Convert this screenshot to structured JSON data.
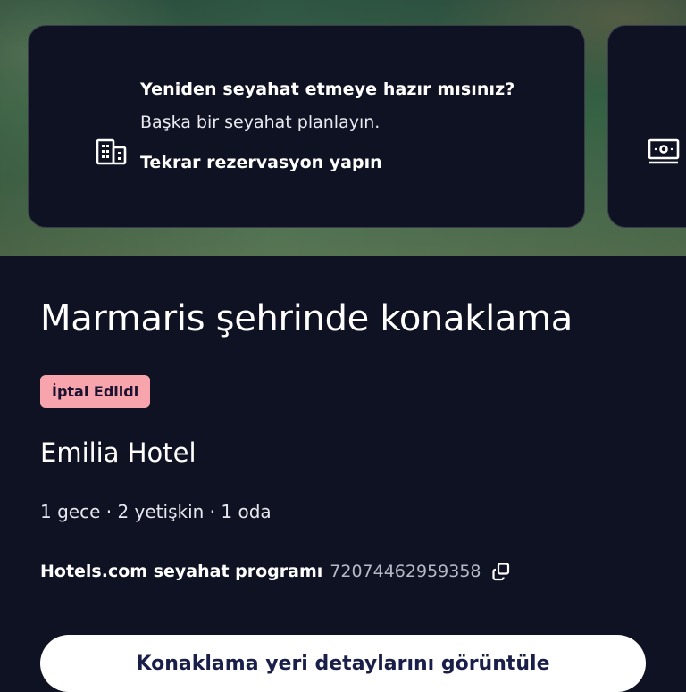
{
  "promo_card": {
    "icon": "building-icon",
    "title": "Yeniden seyahat etmeye hazır mısınız?",
    "subtitle": "Başka bir seyahat planlayın.",
    "link": "Tekrar rezervasyon yapın"
  },
  "next_card": {
    "icon": "money-icon"
  },
  "trip": {
    "title": "Marmaris şehrinde konaklama",
    "status": "İptal Edildi",
    "status_color": "#f7a4ac",
    "hotel_name": "Emilia Hotel",
    "details": "1 gece · 2 yetişkin · 1 oda",
    "itinerary_label": "Hotels.com seyahat programı",
    "itinerary_number": "72074462959358",
    "copy_icon": "copy-icon"
  },
  "actions": {
    "view_details": "Konaklama yeri detaylarını görüntüle"
  },
  "colors": {
    "background": "#0f1222",
    "button_text": "#1a1f4a"
  }
}
